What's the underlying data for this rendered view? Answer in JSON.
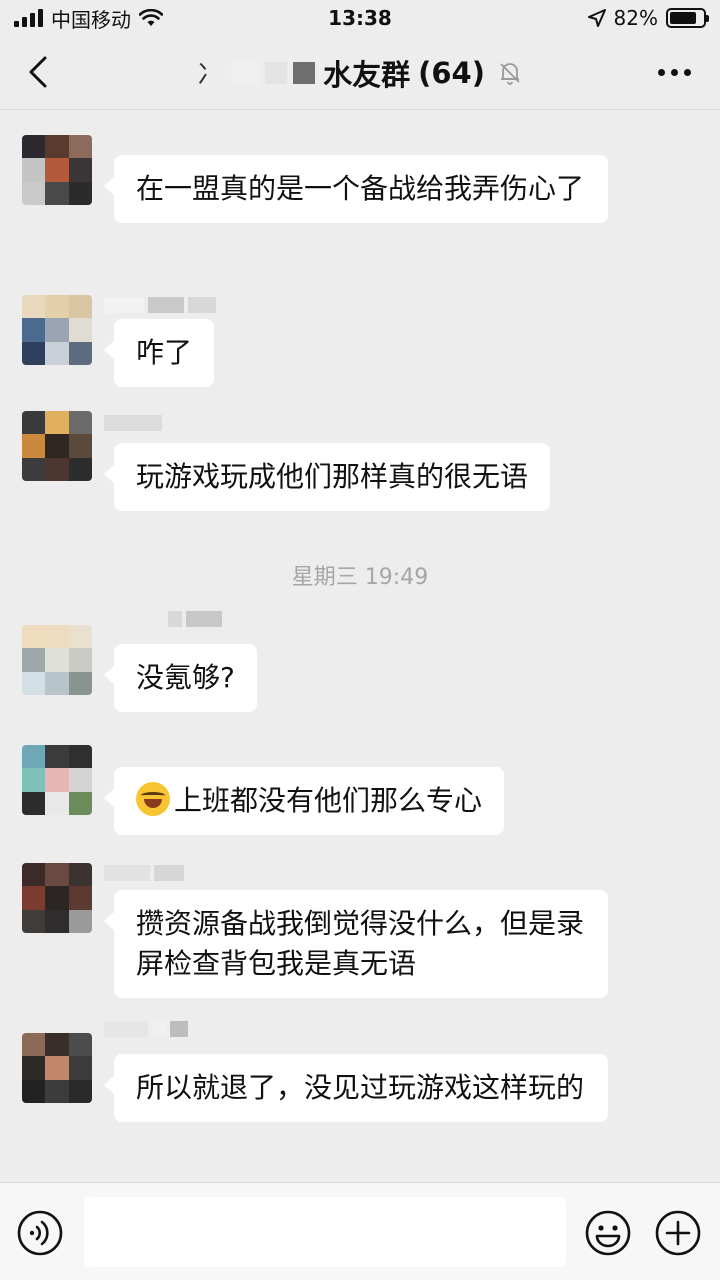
{
  "status_bar": {
    "carrier": "中国移动",
    "time": "13:38",
    "battery_percent": "82%",
    "battery_level": 0.82
  },
  "nav": {
    "title_visible": "水友群",
    "member_count": "(64)",
    "title_prefix_char": "冫",
    "icons": [
      "back-arrow-icon",
      "bell-muted-icon",
      "more-dots-icon"
    ]
  },
  "messages": [
    {
      "text": "在一盟真的是一个备战给我弄伤心了"
    },
    {
      "text": "咋了"
    },
    {
      "text": "玩游戏玩成他们那样真的很无语"
    },
    {
      "text": "没氪够?"
    },
    {
      "text": "上班都没有他们那么专心",
      "emoji": "face-with-tears-of-joy-icon"
    },
    {
      "text": "攒资源备战我倒觉得没什么，但是录屏检查背包我是真无语"
    },
    {
      "text": "所以就退了，没见过玩游戏这样玩的"
    }
  ],
  "time_separator": "星期三 19:49",
  "input_bar": {
    "icons": [
      "voice-icon",
      "emoji-icon",
      "plus-icon"
    ]
  },
  "colors": {
    "background": "#ededed",
    "bubble": "#ffffff",
    "timestamp": "#a6a6a6",
    "input_bar": "#f7f7f7"
  }
}
